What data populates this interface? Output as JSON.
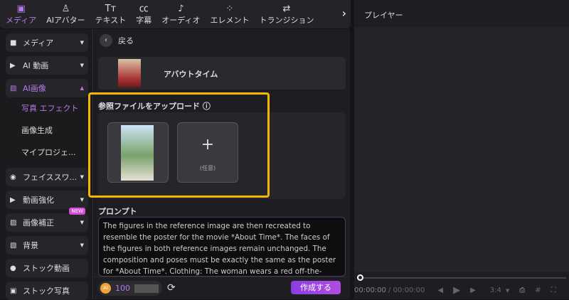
{
  "toolbar": {
    "tabs": [
      {
        "label": "メディア",
        "icon": "media-icon"
      },
      {
        "label": "AIアバター",
        "icon": "avatar-icon"
      },
      {
        "label": "テキスト",
        "icon": "text-icon"
      },
      {
        "label": "字幕",
        "icon": "caption-icon"
      },
      {
        "label": "オーディオ",
        "icon": "audio-icon"
      },
      {
        "label": "エレメント",
        "icon": "element-icon"
      },
      {
        "label": "トランジション",
        "icon": "transition-icon"
      }
    ]
  },
  "sidebar": {
    "items": [
      {
        "label": "メディア"
      },
      {
        "label": "AI 動画"
      },
      {
        "label": "AI画像"
      },
      {
        "label": "フェイススワ..."
      },
      {
        "label": "動画強化"
      },
      {
        "label": "画像補正",
        "badge": "NEW"
      },
      {
        "label": "背景"
      },
      {
        "label": "ストック動画"
      },
      {
        "label": "ストック写真"
      }
    ],
    "sub": [
      "写真 エフェクト",
      "画像生成",
      "マイプロジェ..."
    ]
  },
  "main": {
    "back": "戻る",
    "movie_title": "アバウトタイム",
    "upload_label": "参照ファイルをアップロード",
    "optional": "(任意)",
    "prompt_label": "プロンプト",
    "prompt": "The figures in the reference image are then recreated to resemble the poster for the movie *About Time*. The faces of the figures in both reference images remain unchanged. The composition and poses must be exactly the same as the poster for *About Time*. Clothing: The woman wears a red off-the-shoulder dress made of",
    "credits": "100",
    "create": "作成する"
  },
  "player": {
    "title": "プレイヤー",
    "time_current": "00:00:00",
    "time_total": "/ 00:00:00",
    "ratio": "3:4",
    "progress": 0
  },
  "colors": {
    "accent": "#b57be8",
    "highlight": "#f5b800"
  }
}
